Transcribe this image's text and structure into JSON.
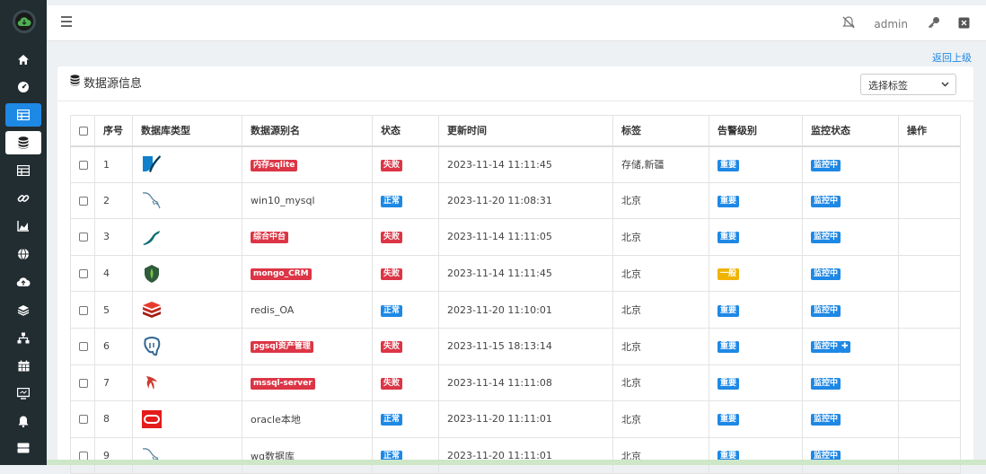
{
  "header": {
    "user": "admin"
  },
  "nav": {
    "back_label": "返回上级"
  },
  "card": {
    "title": "数据源信息"
  },
  "filter": {
    "selected": "选择标签"
  },
  "table": {
    "columns": [
      "序号",
      "数据库类型",
      "数据源别名",
      "状态",
      "更新时间",
      "标签",
      "告警级别",
      "监控状态",
      "操作"
    ],
    "rows": [
      {
        "no": "1",
        "db_icon": "sqlite-icon",
        "alias": "内存sqlite",
        "alias_style": "badge-red",
        "status": "失败",
        "status_color": "#dc3545",
        "updated": "2023-11-14 11:11:45",
        "tag": "存储,新疆",
        "alert": "重要",
        "alert_color": "#1e88e5",
        "monitor": "监控中"
      },
      {
        "no": "2",
        "db_icon": "mysql-icon",
        "alias": "win10_mysql",
        "alias_style": "text",
        "status": "正常",
        "status_color": "#1e88e5",
        "updated": "2023-11-20 11:08:31",
        "tag": "北京",
        "alert": "重要",
        "alert_color": "#1e88e5",
        "monitor": "监控中"
      },
      {
        "no": "3",
        "db_icon": "mariadb-icon",
        "alias": "综合中台",
        "alias_style": "badge-red",
        "status": "失败",
        "status_color": "#dc3545",
        "updated": "2023-11-14 11:11:05",
        "tag": "北京",
        "alert": "重要",
        "alert_color": "#1e88e5",
        "monitor": "监控中"
      },
      {
        "no": "4",
        "db_icon": "mongodb-icon",
        "alias": "mongo_CRM",
        "alias_style": "badge-red",
        "status": "失败",
        "status_color": "#dc3545",
        "updated": "2023-11-14 11:11:45",
        "tag": "北京",
        "alert": "一般",
        "alert_color": "#f0b400",
        "monitor": "监控中"
      },
      {
        "no": "5",
        "db_icon": "redis-icon",
        "alias": "redis_OA",
        "alias_style": "text",
        "status": "正常",
        "status_color": "#1e88e5",
        "updated": "2023-11-20 11:10:01",
        "tag": "北京",
        "alert": "重要",
        "alert_color": "#1e88e5",
        "monitor": "监控中"
      },
      {
        "no": "6",
        "db_icon": "postgresql-icon",
        "alias": "pgsql资产管理",
        "alias_style": "badge-red",
        "status": "失败",
        "status_color": "#dc3545",
        "updated": "2023-11-15 18:13:14",
        "tag": "北京",
        "alert": "重要",
        "alert_color": "#1e88e5",
        "monitor": "监控中"
      },
      {
        "no": "7",
        "db_icon": "mssql-icon",
        "alias": "mssql-server",
        "alias_style": "badge-red",
        "status": "失败",
        "status_color": "#dc3545",
        "updated": "2023-11-14 11:11:08",
        "tag": "北京",
        "alert": "重要",
        "alert_color": "#1e88e5",
        "monitor": "监控中"
      },
      {
        "no": "8",
        "db_icon": "oracle-icon",
        "alias": "oracle本地",
        "alias_style": "text",
        "status": "正常",
        "status_color": "#1e88e5",
        "updated": "2023-11-20 11:11:01",
        "tag": "北京",
        "alert": "重要",
        "alert_color": "#1e88e5",
        "monitor": "监控中"
      },
      {
        "no": "9",
        "db_icon": "mysql-icon",
        "alias": "wg数据库",
        "alias_style": "text",
        "status": "正常",
        "status_color": "#1e88e5",
        "updated": "2023-11-20 11:11:01",
        "tag": "北京",
        "alert": "重要",
        "alert_color": "#1e88e5",
        "monitor": "监控中"
      }
    ]
  },
  "colors": {
    "sidebar_bg": "#222d32",
    "accent": "#1e88e5",
    "danger": "#dc3545",
    "warning": "#f0b400"
  }
}
